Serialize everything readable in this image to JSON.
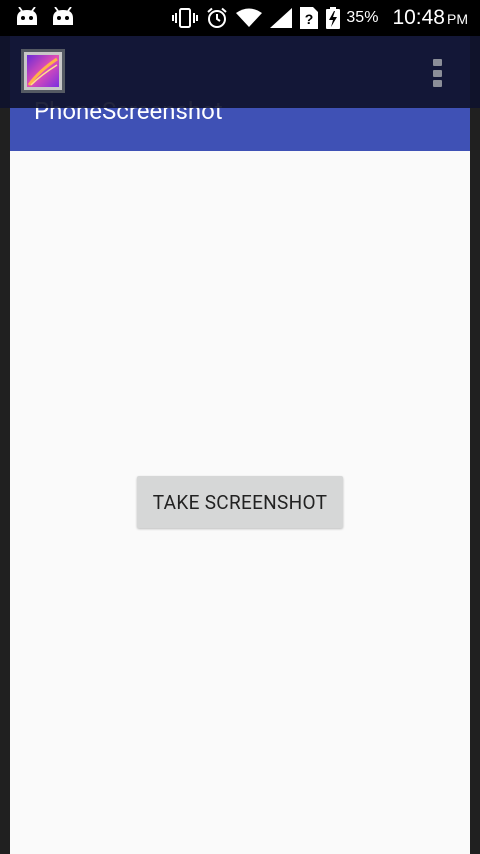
{
  "status_bar": {
    "battery_percent": "35%",
    "time": "10:48",
    "ampm": "PM"
  },
  "app": {
    "title": "PhoneScreenshot",
    "primary_color": "#3f51b5",
    "take_screenshot_label": "TAKE SCREENSHOT"
  }
}
